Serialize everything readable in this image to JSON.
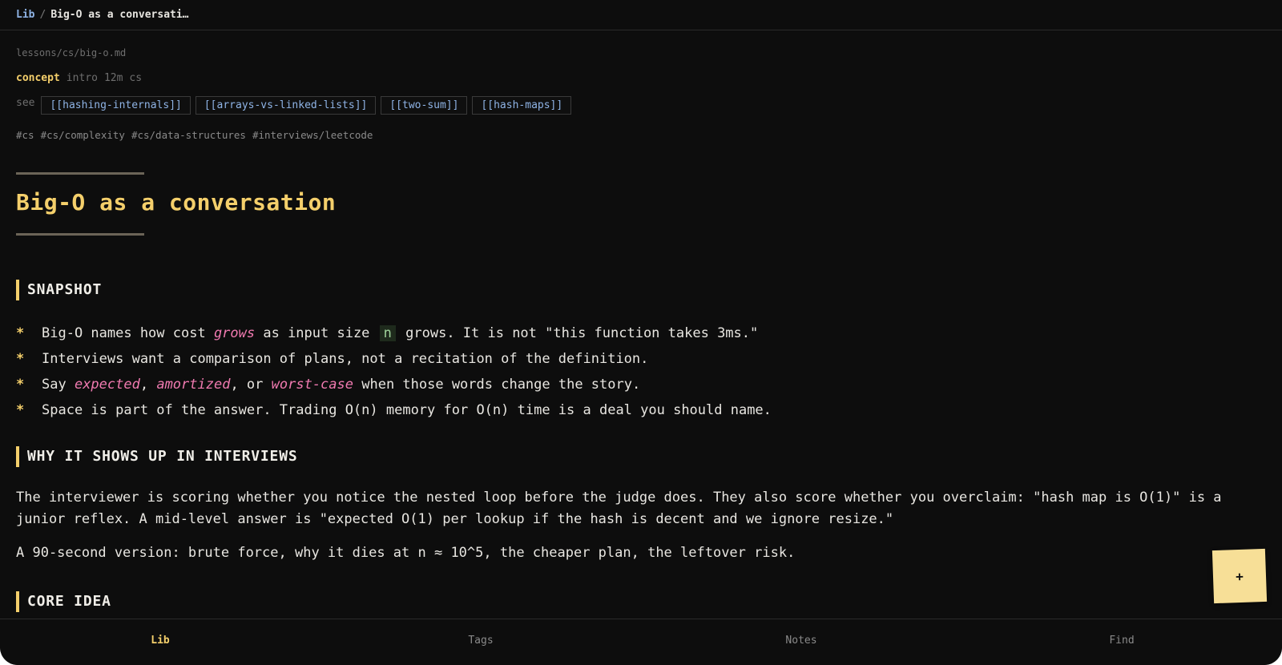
{
  "breadcrumb": {
    "root": "Lib",
    "separator": "/",
    "current": "Big-O as a conversati…"
  },
  "note": {
    "filepath": "lessons/cs/big-o.md",
    "meta": {
      "kind": "concept",
      "level": "intro",
      "duration": "12m",
      "area": "cs"
    },
    "see_label": "see",
    "links": [
      "[[hashing-internals]]",
      "[[arrays-vs-linked-lists]]",
      "[[two-sum]]",
      "[[hash-maps]]"
    ],
    "tags": [
      "#cs",
      "#cs/complexity",
      "#cs/data-structures",
      "#interviews/leetcode"
    ],
    "title": "Big-O as a conversation"
  },
  "sections": {
    "snapshot": {
      "heading": "SNAPSHOT",
      "bullet_marker": "*",
      "b1": {
        "t1": "Big-O names how cost ",
        "em1": "grows",
        "t2": " as input size ",
        "code1": "n",
        "t3": " grows. It is not \"this function takes 3ms.\""
      },
      "b2": {
        "t1": "Interviews want a comparison of plans, not a recitation of the definition."
      },
      "b3": {
        "t1": "Say ",
        "em1": "expected",
        "t2": ", ",
        "em2": "amortized",
        "t3": ", or ",
        "em3": "worst-case",
        "t4": " when those words change the story."
      },
      "b4": {
        "t1": "Space is part of the answer. Trading O(n) memory for O(n) time is a deal you should name."
      }
    },
    "why": {
      "heading": "WHY IT SHOWS UP IN INTERVIEWS",
      "p1": "The interviewer is scoring whether you notice the nested loop before the judge does. They also score whether you overclaim: \"hash map is O(1)\" is a junior reflex. A mid-level answer is \"expected O(1) per lookup if the hash is decent and we ignore resize.\"",
      "p2": "A 90-second version: brute force, why it dies at n ≈ 10^5, the cheaper plan, the leftover risk."
    },
    "core": {
      "heading": "CORE IDEA"
    }
  },
  "fab": {
    "label": "+"
  },
  "bottom_nav": {
    "items": [
      "Lib",
      "Tags",
      "Notes",
      "Find"
    ],
    "active": "Lib"
  },
  "colors": {
    "background": "#0d0d0d",
    "accent": "#f4cf6b",
    "link": "#8fb4e6",
    "emphasis": "#f07ab0",
    "fab": "#f7df97"
  }
}
